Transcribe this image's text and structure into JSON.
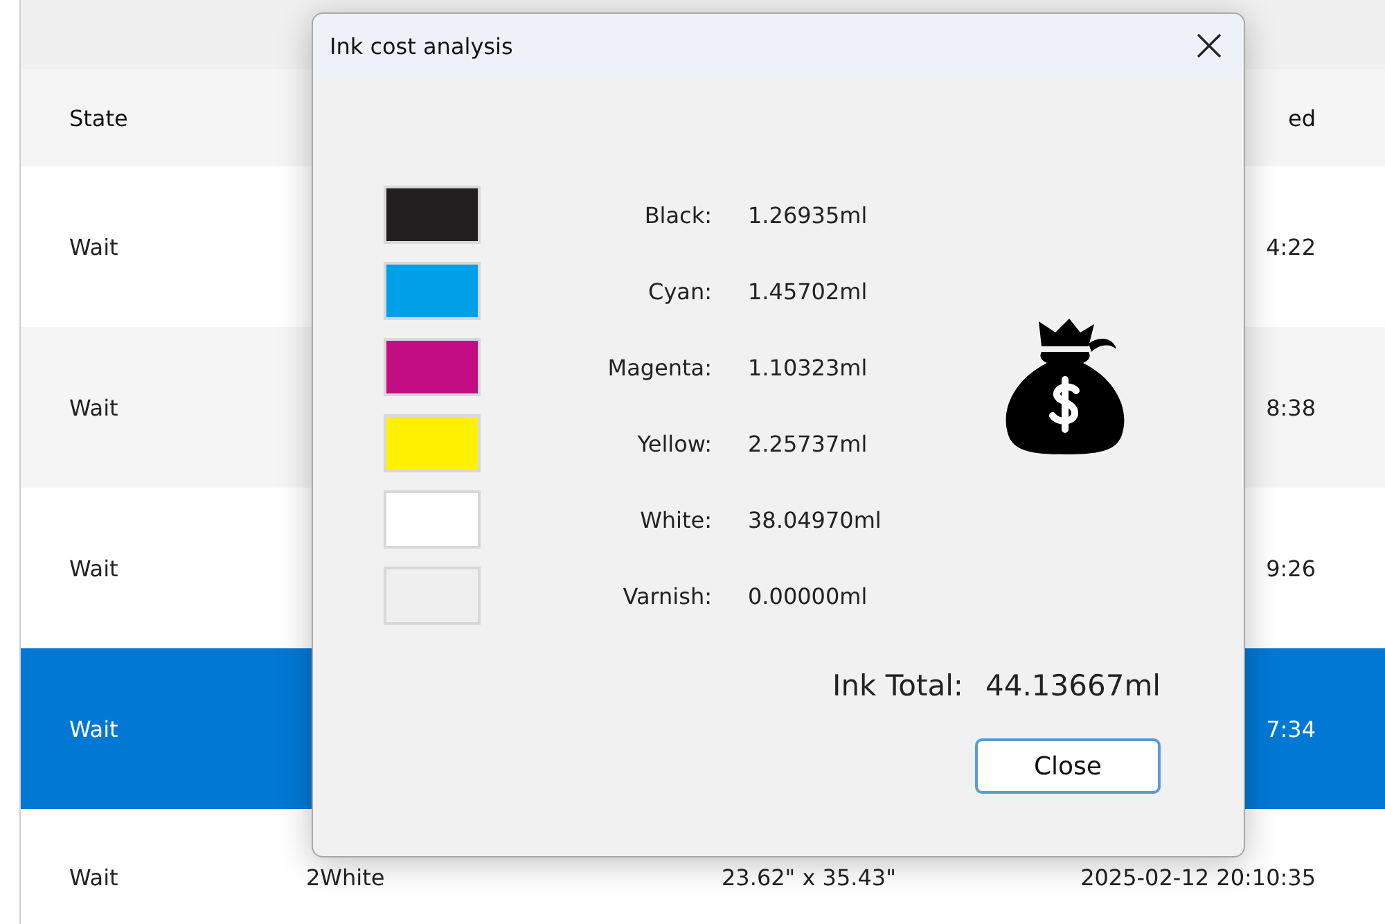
{
  "table": {
    "columns": [
      "State",
      "ed"
    ],
    "rows": [
      {
        "state": "Wait",
        "cells": [],
        "last": "4:22",
        "selected": false
      },
      {
        "state": "Wait",
        "cells": [],
        "last": "8:38",
        "selected": false
      },
      {
        "state": "Wait",
        "cells": [],
        "last": "9:26",
        "selected": false
      },
      {
        "state": "Wait",
        "cells": [],
        "last": "7:34",
        "selected": true
      },
      {
        "state": "Wait",
        "cells": [
          "2White",
          "23.62\" x 35.43\""
        ],
        "last": "2025-02-12 20:10:35",
        "selected": false
      }
    ]
  },
  "dialog": {
    "title": "Ink cost analysis",
    "inks": [
      {
        "label": "Black:",
        "value": "1.26935ml",
        "color": "#231f20"
      },
      {
        "label": "Cyan:",
        "value": "1.45702ml",
        "color": "#00a0e9"
      },
      {
        "label": "Magenta:",
        "value": "1.10323ml",
        "color": "#c30d82"
      },
      {
        "label": "Yellow:",
        "value": "2.25737ml",
        "color": "#fff100"
      },
      {
        "label": "White:",
        "value": "38.04970ml",
        "color": "#ffffff"
      },
      {
        "label": "Varnish:",
        "value": "0.00000ml",
        "color": "#efefef"
      }
    ],
    "total_label": "Ink Total:",
    "total_value": "44.13667ml",
    "button": "Close"
  }
}
